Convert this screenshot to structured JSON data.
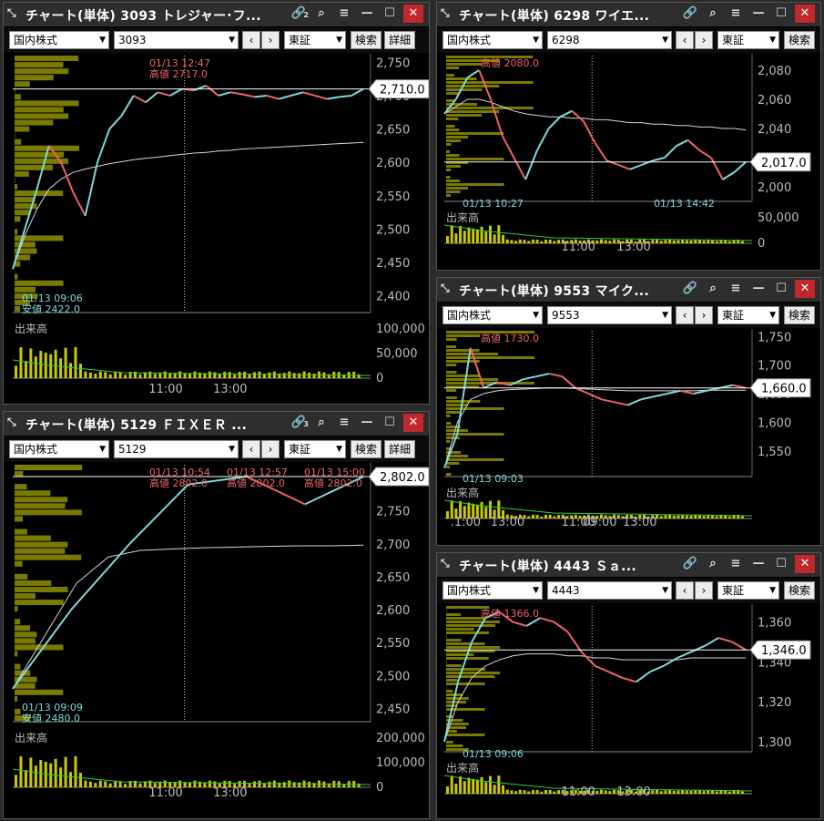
{
  "colors": {
    "up": "#7fd9d9",
    "down": "#f06565",
    "hist": "#8f8f00",
    "vol": "#c9c900"
  },
  "common": {
    "market": "国内株式",
    "exchange": "東証",
    "search": "検索",
    "detail": "詳細",
    "volume_label": "出来高",
    "nav_prev": "‹",
    "nav_next": "›"
  },
  "icons": {
    "pin": "pin-icon",
    "link": "link-icon",
    "search": "search-icon",
    "menu": "menu-icon",
    "minimize": "minimize-icon",
    "maximize": "maximize-icon",
    "close": "close-icon"
  },
  "windows": [
    {
      "title": "チャート(単体) 3093 トレジャー･フ...",
      "code": "3093",
      "link_badge": "2",
      "has_detail": true,
      "chart_data": {
        "type": "line",
        "ylim": [
          2375,
          2760
        ],
        "yticks": [
          "2,750",
          "2,700",
          "2,650",
          "2,600",
          "2,550",
          "2,500",
          "2,450",
          "2,400"
        ],
        "last": "2,710.0",
        "annotations": [
          {
            "text": "01/13 12:47",
            "kind": "high"
          },
          {
            "text": "高値 2717.0",
            "kind": "high"
          },
          {
            "text": "01/13 09:06",
            "kind": "low"
          },
          {
            "text": "安値 2422.0",
            "kind": "low"
          }
        ],
        "volume_ticks": [
          "100,000",
          "50,000",
          "0"
        ],
        "xticks": [
          "11:00",
          "13:00"
        ],
        "series": [
          2440,
          2500,
          2560,
          2625,
          2600,
          2555,
          2520,
          2600,
          2650,
          2670,
          2700,
          2690,
          2705,
          2700,
          2710,
          2708,
          2715,
          2700,
          2705,
          2702,
          2698,
          2700,
          2695,
          2700,
          2705,
          2700,
          2695,
          2698,
          2700,
          2710
        ],
        "vwap": [
          2440,
          2490,
          2530,
          2560,
          2575,
          2585,
          2590,
          2594,
          2598,
          2601,
          2604,
          2606,
          2608,
          2610,
          2612,
          2614,
          2615,
          2617,
          2618,
          2620,
          2621,
          2622,
          2623,
          2624,
          2625,
          2626,
          2627,
          2628,
          2629,
          2630
        ]
      }
    },
    {
      "title": "チャート(単体) 6298 ワイエ...",
      "code": "6298",
      "link_badge": "",
      "has_detail": false,
      "chart_data": {
        "type": "line",
        "ylim": [
          1990,
          2090
        ],
        "yticks": [
          "2,080",
          "2,060",
          "2,040",
          "2,020",
          "2,000"
        ],
        "last": "2,017.0",
        "annotations": [
          {
            "text": "高値 2080.0",
            "kind": "high"
          },
          {
            "text": "01/13 10:27",
            "kind": "low"
          },
          {
            "text": "01/13 14:42",
            "kind": "low"
          }
        ],
        "volume_ticks": [
          "50,000",
          "0"
        ],
        "xticks": [
          "11:00",
          "13:00"
        ],
        "series": [
          2050,
          2060,
          2075,
          2080,
          2060,
          2035,
          2020,
          2005,
          2025,
          2040,
          2048,
          2052,
          2045,
          2030,
          2018,
          2015,
          2012,
          2015,
          2018,
          2020,
          2028,
          2032,
          2025,
          2020,
          2005,
          2010,
          2017
        ],
        "vwap": [
          2050,
          2055,
          2060,
          2060,
          2058,
          2055,
          2052,
          2050,
          2049,
          2048,
          2048,
          2047,
          2047,
          2046,
          2046,
          2045,
          2044,
          2044,
          2043,
          2043,
          2042,
          2042,
          2041,
          2041,
          2040,
          2040,
          2039
        ]
      }
    },
    {
      "title": "チャート(単体) 9553 マイク...",
      "code": "9553",
      "link_badge": "",
      "has_detail": false,
      "chart_data": {
        "type": "line",
        "ylim": [
          1505,
          1760
        ],
        "yticks": [
          "1,750",
          "1,700",
          "1,650",
          "1,600",
          "1,550"
        ],
        "last": "1,660.0",
        "annotations": [
          {
            "text": "高値 1730.0",
            "kind": "high"
          },
          {
            "text": "01/13 09:03",
            "kind": "low"
          }
        ],
        "volume_ticks": [],
        "xticks": [
          ".1:00",
          "13:00",
          "11:00",
          "13:00",
          "09:00"
        ],
        "series": [
          1520,
          1580,
          1730,
          1660,
          1670,
          1665,
          1675,
          1680,
          1685,
          1680,
          1660,
          1650,
          1640,
          1635,
          1630,
          1640,
          1645,
          1650,
          1655,
          1650,
          1655,
          1660,
          1665,
          1660
        ],
        "vwap": [
          1520,
          1600,
          1640,
          1650,
          1655,
          1657,
          1658,
          1659,
          1660,
          1660,
          1659,
          1658,
          1657,
          1656,
          1655,
          1655,
          1655,
          1655,
          1655,
          1655,
          1656,
          1656,
          1656,
          1656
        ]
      }
    },
    {
      "title": "チャート(単体) 5129 ＦＩＸＥＲ ...",
      "code": "5129",
      "link_badge": "3",
      "has_detail": true,
      "chart_data": {
        "type": "line",
        "ylim": [
          2430,
          2820
        ],
        "yticks": [
          "2,800",
          "2,750",
          "2,700",
          "2,650",
          "2,600",
          "2,550",
          "2,500",
          "2,450"
        ],
        "last": "2,802.0",
        "annotations": [
          {
            "text": "01/13 10:54",
            "kind": "high"
          },
          {
            "text": "高値 2802.0",
            "kind": "high"
          },
          {
            "text": "01/13 12:57",
            "kind": "high"
          },
          {
            "text": "高値 2802.0",
            "kind": "high"
          },
          {
            "text": "01/13 15:00",
            "kind": "high"
          },
          {
            "text": "高値 2802.0",
            "kind": "high"
          },
          {
            "text": "01/13 09:09",
            "kind": "low"
          },
          {
            "text": "安値 2480.0",
            "kind": "low"
          }
        ],
        "volume_ticks": [
          "200,000",
          "100,000",
          "0"
        ],
        "xticks": [
          "11:00",
          "13:00"
        ],
        "series": [
          2480,
          2600,
          2700,
          2790,
          2802,
          2760,
          2802
        ],
        "vwap": [
          2480,
          2560,
          2640,
          2680,
          2690,
          2692,
          2694,
          2695,
          2696,
          2697,
          2697,
          2698
        ]
      }
    },
    {
      "title": "チャート(単体) 4443 Ｓａ...",
      "code": "4443",
      "link_badge": "",
      "has_detail": false,
      "chart_data": {
        "type": "line",
        "ylim": [
          1295,
          1368
        ],
        "yticks": [
          "1,360",
          "1,340",
          "1,320",
          "1,300"
        ],
        "last": "1,346.0",
        "annotations": [
          {
            "text": "高値 1366.0",
            "kind": "high"
          },
          {
            "text": "01/13 09:06",
            "kind": "low"
          }
        ],
        "volume_ticks": [],
        "xticks": [
          "11:00",
          "13:00"
        ],
        "series": [
          1300,
          1330,
          1350,
          1362,
          1365,
          1360,
          1358,
          1362,
          1360,
          1355,
          1345,
          1338,
          1335,
          1332,
          1330,
          1335,
          1338,
          1342,
          1345,
          1348,
          1352,
          1350,
          1346
        ],
        "vwap": [
          1300,
          1320,
          1332,
          1338,
          1341,
          1343,
          1344,
          1344,
          1344,
          1343,
          1343,
          1342,
          1342,
          1341,
          1341,
          1341,
          1341,
          1341,
          1342,
          1342,
          1342,
          1342,
          1342
        ]
      }
    }
  ]
}
